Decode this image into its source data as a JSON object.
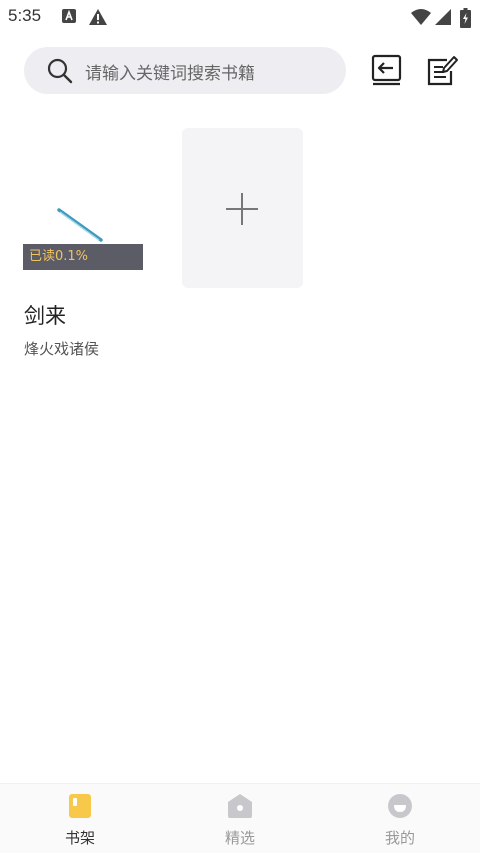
{
  "status_bar": {
    "time": "5:35",
    "icons": [
      "app-notification-icon",
      "warning-icon",
      "wifi-icon",
      "signal-icon",
      "battery-charging-icon"
    ]
  },
  "search": {
    "placeholder": "请输入关键词搜索书籍"
  },
  "toolbar": {
    "icons": [
      "import-book-icon",
      "edit-shelf-icon"
    ]
  },
  "shelf": {
    "books": [
      {
        "title": "剑来",
        "author": "烽火戏诸侯",
        "progress_label": "已读0.1%",
        "progress": 0.1
      }
    ],
    "add_icon": "plus-icon"
  },
  "bottom_nav": {
    "items": [
      {
        "label": "书架",
        "icon": "bookshelf-icon",
        "active": true
      },
      {
        "label": "精选",
        "icon": "featured-icon",
        "active": false
      },
      {
        "label": "我的",
        "icon": "profile-icon",
        "active": false
      }
    ]
  },
  "colors": {
    "accent": "#f8c84a",
    "badge_bg": "#5c5c66",
    "badge_text": "#f1c360",
    "search_bg": "#eeeef2"
  }
}
